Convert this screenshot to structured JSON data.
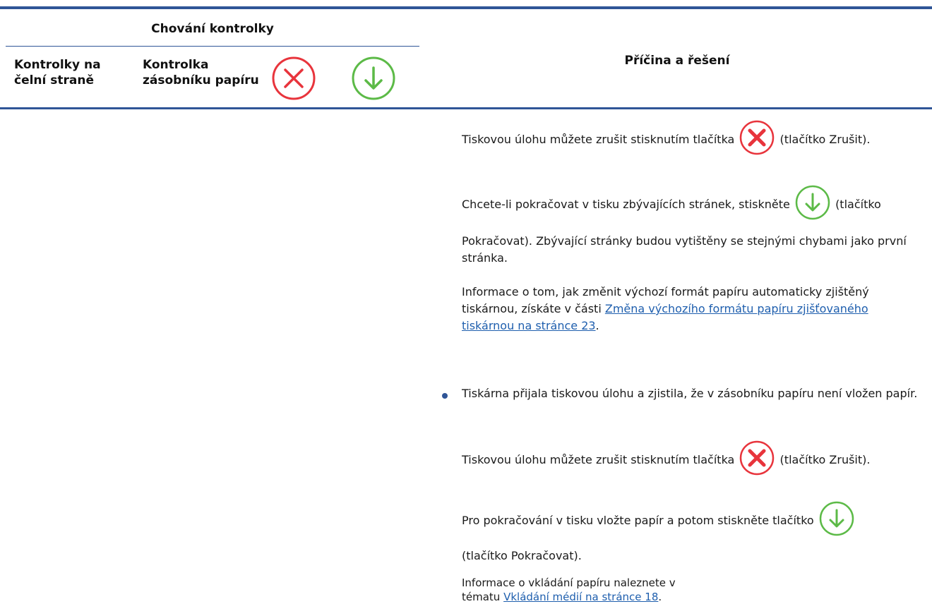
{
  "table_header": {
    "group_heading": "Chování kontrolky",
    "col_front_lights": "Kontrolky na čelní straně",
    "col_tray_light": "Kontrolka zásobníku papíru",
    "col_cause": "Příčina a řešení",
    "header_icons": [
      "cancel-icon",
      "resume-icon"
    ]
  },
  "body": {
    "p1_before": "Tiskovou úlohu můžete zrušit stisknutím tlačítka",
    "p1_after": "(tlačítko Zrušit).",
    "p2_before": "Chcete-li pokračovat v tisku zbývajících stránek, stiskněte",
    "p2_after": "(tlačítko",
    "p2_cont": "Pokračovat). Zbývající stránky budou vytištěny se stejnými chybami jako první stránka.",
    "p3_text": "Informace o tom, jak změnit výchozí formát papíru automaticky zjištěný tiskárnou, získáte v části ",
    "p3_link": "Změna výchozího formátu papíru zjišťovaného tiskárnou na stránce 23",
    "p3_end": ".",
    "bullet_text": "Tiskárna přijala tiskovou úlohu a zjistila, že v zásobníku papíru není vložen papír.",
    "p4_before": "Tiskovou úlohu můžete zrušit stisknutím tlačítka",
    "p4_after": "(tlačítko Zrušit).",
    "p5_before": "Pro pokračování v tisku vložte papír a potom stiskněte tlačítko",
    "p5_cont": "(tlačítko Pokračovat).",
    "p6_text": "Informace o vkládání papíru naleznete v tématu ",
    "p6_link": "Vkládání médií na stránce 18",
    "p6_end": "."
  },
  "colors": {
    "rule": "#2f5597",
    "link": "#1f5fae",
    "cancel": "#e8343c",
    "resume": "#5cba47"
  }
}
